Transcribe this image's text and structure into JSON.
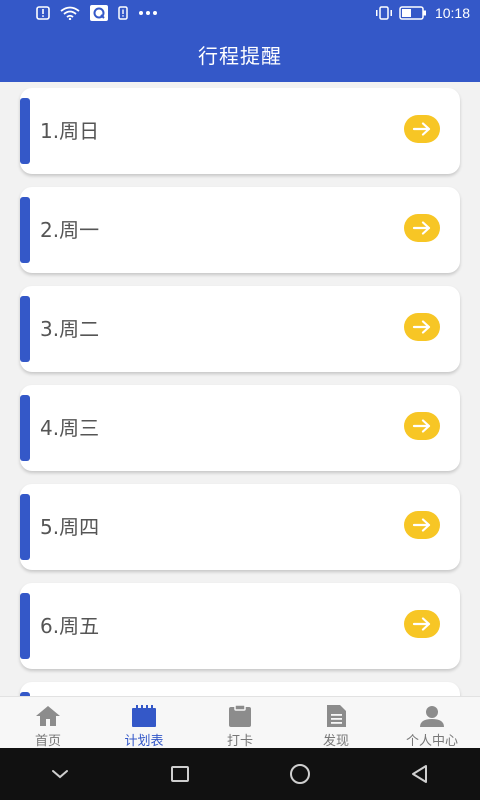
{
  "status_bar": {
    "time": "10:18",
    "icons": [
      "alert-icon",
      "wifi-icon",
      "qq-icon",
      "sim-icon",
      "more-icon",
      "vibrate-icon",
      "battery-icon"
    ]
  },
  "header": {
    "title": "行程提醒"
  },
  "schedule": {
    "items": [
      {
        "label": "1.周日"
      },
      {
        "label": "2.周一"
      },
      {
        "label": "3.周二"
      },
      {
        "label": "4.周三"
      },
      {
        "label": "5.周四"
      },
      {
        "label": "6.周五"
      }
    ]
  },
  "tabs": [
    {
      "label": "首页",
      "icon": "home-icon"
    },
    {
      "label": "计划表",
      "icon": "calendar-icon",
      "active": true
    },
    {
      "label": "打卡",
      "icon": "clipboard-icon"
    },
    {
      "label": "发现",
      "icon": "document-icon"
    },
    {
      "label": "个人中心",
      "icon": "user-icon"
    }
  ],
  "colors": {
    "primary": "#3458c8",
    "arrow_button": "#f7c625",
    "item_text": "#555555",
    "background": "#f2f2f2"
  }
}
